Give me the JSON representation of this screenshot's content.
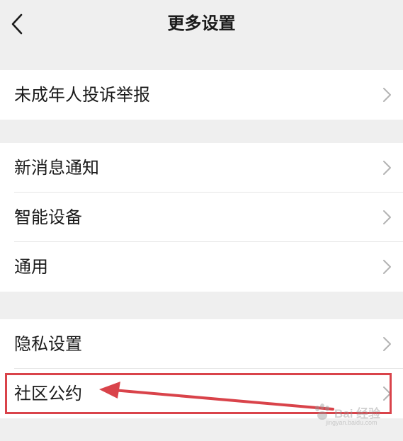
{
  "header": {
    "title": "更多设置",
    "back_icon": "chevron-left-icon"
  },
  "groups": [
    {
      "items": [
        {
          "label": "未成年人投诉举报",
          "icon": "chevron-right-icon"
        }
      ]
    },
    {
      "items": [
        {
          "label": "新消息通知",
          "icon": "chevron-right-icon"
        },
        {
          "label": "智能设备",
          "icon": "chevron-right-icon"
        },
        {
          "label": "通用",
          "icon": "chevron-right-icon"
        }
      ]
    },
    {
      "items": [
        {
          "label": "隐私设置",
          "icon": "chevron-right-icon"
        },
        {
          "label": "社区公约",
          "icon": "chevron-right-icon"
        }
      ]
    }
  ],
  "annotation": {
    "highlight_color": "#d9434a",
    "highlighted_item": "社区公约"
  },
  "watermark": {
    "brand": "Bai 经验",
    "url": "jingyan.baidu.com"
  },
  "colors": {
    "background": "#efefef",
    "card": "#ffffff",
    "text": "#1a1a1a",
    "chevron": "#b3b3b3",
    "divider": "#e6e6e6"
  }
}
